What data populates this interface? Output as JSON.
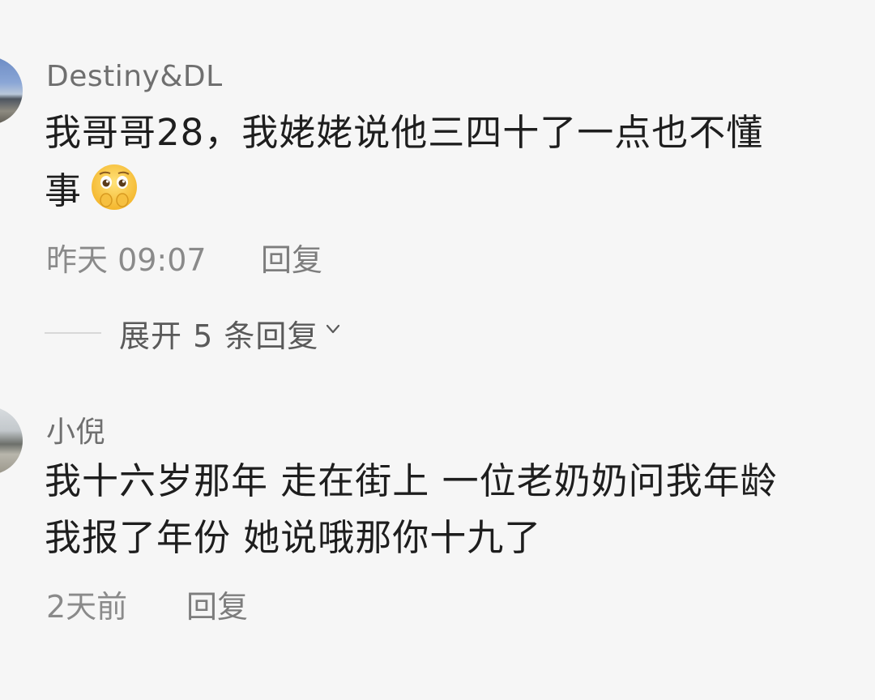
{
  "comments": [
    {
      "username": "Destiny&DL",
      "line1": "我哥哥28，我姥姥说他三四十了一点也不懂",
      "line2": "事",
      "emoji": "pleading-face-emoji",
      "time": "昨天 09:07",
      "reply_label": "回复",
      "expand_label": "展开 5 条回复"
    },
    {
      "username": "小倪",
      "line1": "我十六岁那年 走在街上 一位老奶奶问我年龄",
      "line2": "我报了年份 她说哦那你十九了",
      "time": "2天前",
      "reply_label": "回复"
    }
  ],
  "colors": {
    "background": "#f6f6f6",
    "text": "#1e1e1e",
    "meta": "#8a8a8a",
    "username": "#6f6f6f"
  }
}
